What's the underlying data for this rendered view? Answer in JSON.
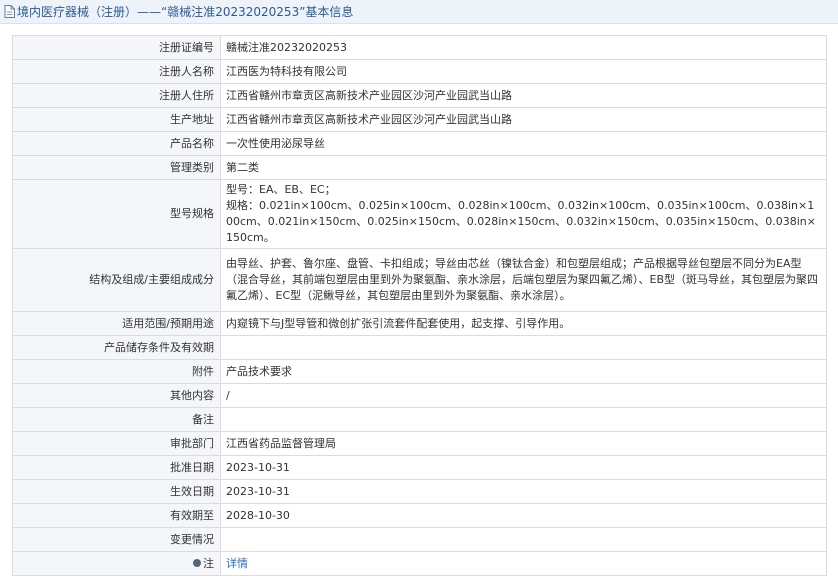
{
  "header": {
    "title": "境内医疗器械（注册）——“赣械注准20232020253”基本信息",
    "icon": "document-icon"
  },
  "rows": [
    {
      "key": "reg_no",
      "label": "注册证编号",
      "value": "赣械注准20232020253"
    },
    {
      "key": "registrant",
      "label": "注册人名称",
      "value": "江西医为特科技有限公司"
    },
    {
      "key": "registrant_address",
      "label": "注册人住所",
      "value": "江西省赣州市章贡区高新技术产业园区沙河产业园武当山路"
    },
    {
      "key": "production_address",
      "label": "生产地址",
      "value": "江西省赣州市章贡区高新技术产业园区沙河产业园武当山路"
    },
    {
      "key": "product_name",
      "label": "产品名称",
      "value": "一次性使用泌尿导丝"
    },
    {
      "key": "category",
      "label": "管理类别",
      "value": "第二类"
    },
    {
      "key": "model_spec",
      "label": "型号规格",
      "value_lines": [
        "型号：EA、EB、EC；",
        "规格：0.021in×100cm、0.025in×100cm、0.028in×100cm、0.032in×100cm、0.035in×100cm、0.038in×100cm、0.021in×150cm、0.025in×150cm、0.028in×150cm、0.032in×150cm、0.035in×150cm、0.038in×150cm。"
      ]
    },
    {
      "key": "structure",
      "label": "结构及组成/主要组成成分",
      "value": "由导丝、护套、鲁尔座、盘管、卡扣组成；导丝由芯丝（镍钛合金）和包塑层组成；产品根据导丝包塑层不同分为EA型（混合导丝，其前端包塑层由里到外为聚氨酯、亲水涂层，后端包塑层为聚四氟乙烯）、EB型（斑马导丝，其包塑层为聚四氟乙烯）、EC型（泥鳅导丝，其包塑层由里到外为聚氨酯、亲水涂层）。"
    },
    {
      "key": "scope",
      "label": "适用范围/预期用途",
      "value": "内窥镜下与J型导管和微创扩张引流套件配套使用，起支撑、引导作用。"
    },
    {
      "key": "storage",
      "label": "产品储存条件及有效期",
      "value": ""
    },
    {
      "key": "attachment",
      "label": "附件",
      "value": "产品技术要求"
    },
    {
      "key": "other",
      "label": "其他内容",
      "value": "/"
    },
    {
      "key": "remark",
      "label": "备注",
      "value": ""
    },
    {
      "key": "approval_dept",
      "label": "审批部门",
      "value": "江西省药品监督管理局"
    },
    {
      "key": "approval_date",
      "label": "批准日期",
      "value": "2023-10-31"
    },
    {
      "key": "effective_date",
      "label": "生效日期",
      "value": "2023-10-31"
    },
    {
      "key": "expiry_date",
      "label": "有效期至",
      "value": "2028-10-30"
    },
    {
      "key": "changes",
      "label": "变更情况",
      "value": ""
    },
    {
      "key": "note",
      "label": "注",
      "value": "详情",
      "icon": "info-bullet-icon"
    }
  ]
}
